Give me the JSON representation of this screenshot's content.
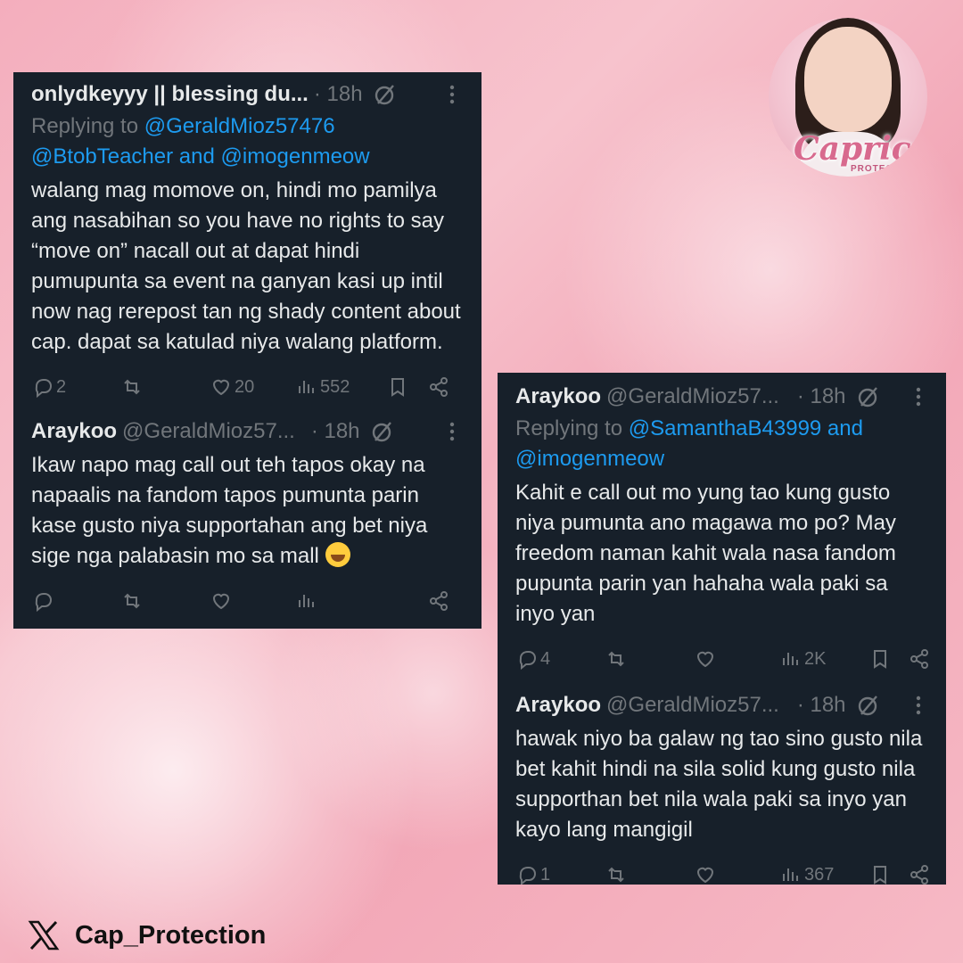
{
  "left_card": {
    "tweet1": {
      "author": "onlydkeyyy || blessing du...",
      "handle": "",
      "time": "· 18h",
      "replying_prefix": "Replying to",
      "reply_mentions_line1": "@GeraldMioz57476",
      "reply_mentions_line2": "@BtobTeacher and @imogenmeow",
      "body": "walang mag momove on, hindi mo pamilya ang nasabihan so you have no rights to say “move on” nacall out at dapat hindi pumupunta sa event na ganyan kasi up intil now nag rerepost tan ng shady content about cap. dapat sa katulad niya walang platform.",
      "replies": "2",
      "retweets": "",
      "likes": "20",
      "views": "552"
    },
    "tweet2": {
      "author": "Araykoo",
      "handle": "@GeraldMioz57...",
      "time": "· 18h",
      "body": "Ikaw napo mag call out teh tapos okay na napaalis na fandom tapos pumunta parin kase gusto niya supportahan ang bet niya sige nga palabasin mo sa mall",
      "emoji": "rofl-emoji"
    }
  },
  "right_card": {
    "tweet1": {
      "author": "Araykoo",
      "handle": "@GeraldMioz57...",
      "time": "· 18h",
      "replying_prefix": "Replying to",
      "reply_mentions_line1": "@SamanthaB43999 and",
      "reply_mentions_line2": "@imogenmeow",
      "body": "Kahit e call out mo yung tao kung gusto niya pumunta ano magawa mo po? May freedom naman kahit wala nasa fandom pupunta parin yan hahaha wala paki sa inyo yan",
      "replies": "4",
      "likes": "",
      "views": "2K"
    },
    "tweet2": {
      "author": "Araykoo",
      "handle": "@GeraldMioz57...",
      "time": "· 18h",
      "body": "hawak niyo ba galaw ng tao sino gusto nila bet kahit hindi na sila solid kung gusto nila supporthan bet nila wala paki sa inyo yan kayo lang mangigil",
      "replies": "1",
      "likes": "",
      "views": "367"
    }
  },
  "avatar": {
    "brand": "Caprice",
    "sub": "PROTECTIO"
  },
  "footer": {
    "account": "Cap_Protection",
    "icon": "x-logo-icon"
  },
  "colors": {
    "card_bg": "#17202a",
    "text": "#e7e9ea",
    "muted": "#71767b",
    "link": "#1d9bf0"
  }
}
